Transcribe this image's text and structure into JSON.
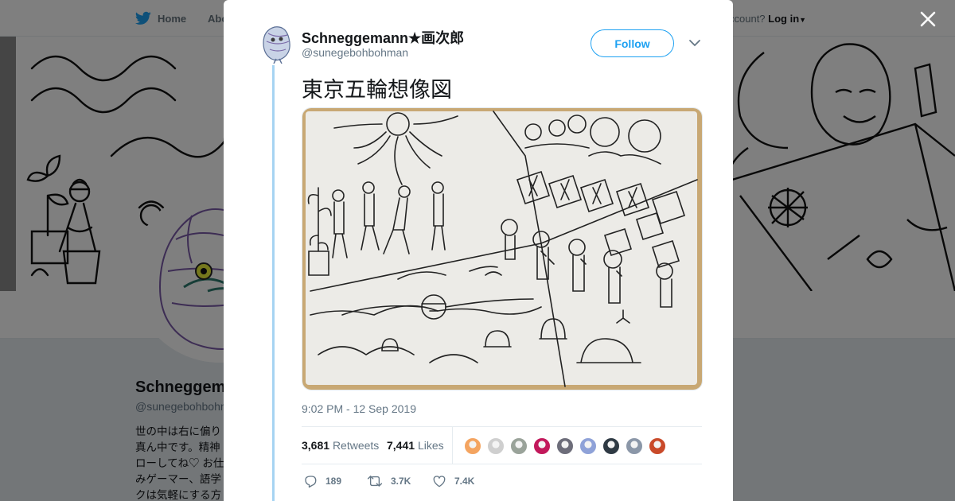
{
  "nav": {
    "home_label": "Home",
    "about_label": "Abo",
    "account_prompt": "ccount?",
    "login_label": "Log in",
    "brand_color": "#1da1f2"
  },
  "profile": {
    "display_name": "Schneggem",
    "handle": "@sunegebohbohm",
    "bio_lines": [
      "世の中は右に偏り",
      "真ん中です。精神",
      "ローしてね♡ お仕",
      "みゲーマー、語学",
      "クは気軽にする方"
    ]
  },
  "tweet": {
    "author_name": "Schneggemann★画次郎",
    "author_handle": "@sunegebohbohman",
    "follow_label": "Follow",
    "text": "東京五輪想像図",
    "timestamp": "9:02 PM - 12 Sep 2019",
    "retweets_count": "3,681",
    "retweets_label": "Retweets",
    "likes_count": "7,441",
    "likes_label": "Likes",
    "reply_count": "189",
    "retweet_action_count": "3.7K",
    "like_action_count": "7.4K",
    "liker_avatar_colors": [
      "#f4a460",
      "#cfcfcf",
      "#9aa39a",
      "#c2185b",
      "#6d6d7a",
      "#8fa2d8",
      "#2f3a44",
      "#8b97a8",
      "#c94a2a"
    ]
  }
}
